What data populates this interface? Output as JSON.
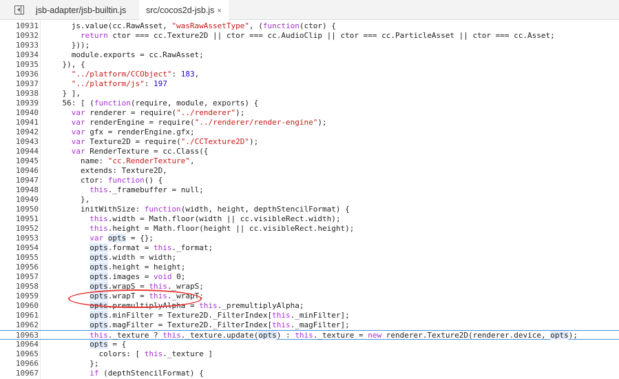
{
  "tabs": [
    {
      "label": "jsb-adapter/jsb-builtin.js"
    },
    {
      "label": "src/cocos2d-jsb.js",
      "close": "×"
    }
  ],
  "lines": [
    {
      "n": "10931",
      "t": "      js.value(cc.RawAsset, \"wasRawAssetType\", (function(ctor) {"
    },
    {
      "n": "10932",
      "t": "        return ctor === cc.Texture2D || ctor === cc.AudioClip || ctor === cc.ParticleAsset || ctor === cc.Asset;"
    },
    {
      "n": "10933",
      "t": "      }));"
    },
    {
      "n": "10934",
      "t": "      module.exports = cc.RawAsset;"
    },
    {
      "n": "10935",
      "t": "    }), {"
    },
    {
      "n": "10936",
      "t": "      \"../platform/CCObject\": 183,"
    },
    {
      "n": "10937",
      "t": "      \"../platform/js\": 197"
    },
    {
      "n": "10938",
      "t": "    } ],"
    },
    {
      "n": "10939",
      "t": "    56: [ (function(require, module, exports) {"
    },
    {
      "n": "10940",
      "t": "      var renderer = require(\"../renderer\");"
    },
    {
      "n": "10941",
      "t": "      var renderEngine = require(\"../renderer/render-engine\");"
    },
    {
      "n": "10942",
      "t": "      var gfx = renderEngine.gfx;"
    },
    {
      "n": "10943",
      "t": "      var Texture2D = require(\"./CCTexture2D\");"
    },
    {
      "n": "10944",
      "t": "      var RenderTexture = cc.Class({"
    },
    {
      "n": "10945",
      "t": "        name: \"cc.RenderTexture\","
    },
    {
      "n": "10946",
      "t": "        extends: Texture2D,"
    },
    {
      "n": "10947",
      "t": "        ctor: function() {"
    },
    {
      "n": "10948",
      "t": "          this._framebuffer = null;"
    },
    {
      "n": "10949",
      "t": "        },"
    },
    {
      "n": "10950",
      "t": "        initWithSize: function(width, height, depthStencilFormat) {"
    },
    {
      "n": "10951",
      "t": "          this.width = Math.floor(width || cc.visibleRect.width);"
    },
    {
      "n": "10952",
      "t": "          this.height = Math.floor(height || cc.visibleRect.height);"
    },
    {
      "n": "10953",
      "t": "          var opts = {};"
    },
    {
      "n": "10954",
      "t": "          opts.format = this._format;"
    },
    {
      "n": "10955",
      "t": "          opts.width = width;"
    },
    {
      "n": "10956",
      "t": "          opts.height = height;"
    },
    {
      "n": "10957",
      "t": "          opts.images = void 0;"
    },
    {
      "n": "10958",
      "t": "          opts.wrapS = this._wrapS;"
    },
    {
      "n": "10959",
      "t": "          opts.wrapT = this._wrapT;"
    },
    {
      "n": "10960",
      "t": "          opts.premultiplyAlpha = this._premultiplyAlpha;"
    },
    {
      "n": "10961",
      "t": "          opts.minFilter = Texture2D._FilterIndex[this._minFilter];"
    },
    {
      "n": "10962",
      "t": "          opts.magFilter = Texture2D._FilterIndex[this._magFilter];"
    },
    {
      "n": "10963",
      "t": "          this._texture ? this._texture.update(opts) : this._texture = new renderer.Texture2D(renderer.device, opts);"
    },
    {
      "n": "10964",
      "t": "          opts = {"
    },
    {
      "n": "10965",
      "t": "            colors: [ this._texture ]"
    },
    {
      "n": "10966",
      "t": "          };"
    },
    {
      "n": "10967",
      "t": "          if (depthStencilFormat) {"
    }
  ],
  "highlighted_line": "10963",
  "annotated_line": "10957",
  "colors": {
    "keyword": "#a72dd6",
    "string": "#c41a16",
    "number": "#1c00cf",
    "annotation": "#e53935",
    "current_line_border": "#4a90d9"
  }
}
